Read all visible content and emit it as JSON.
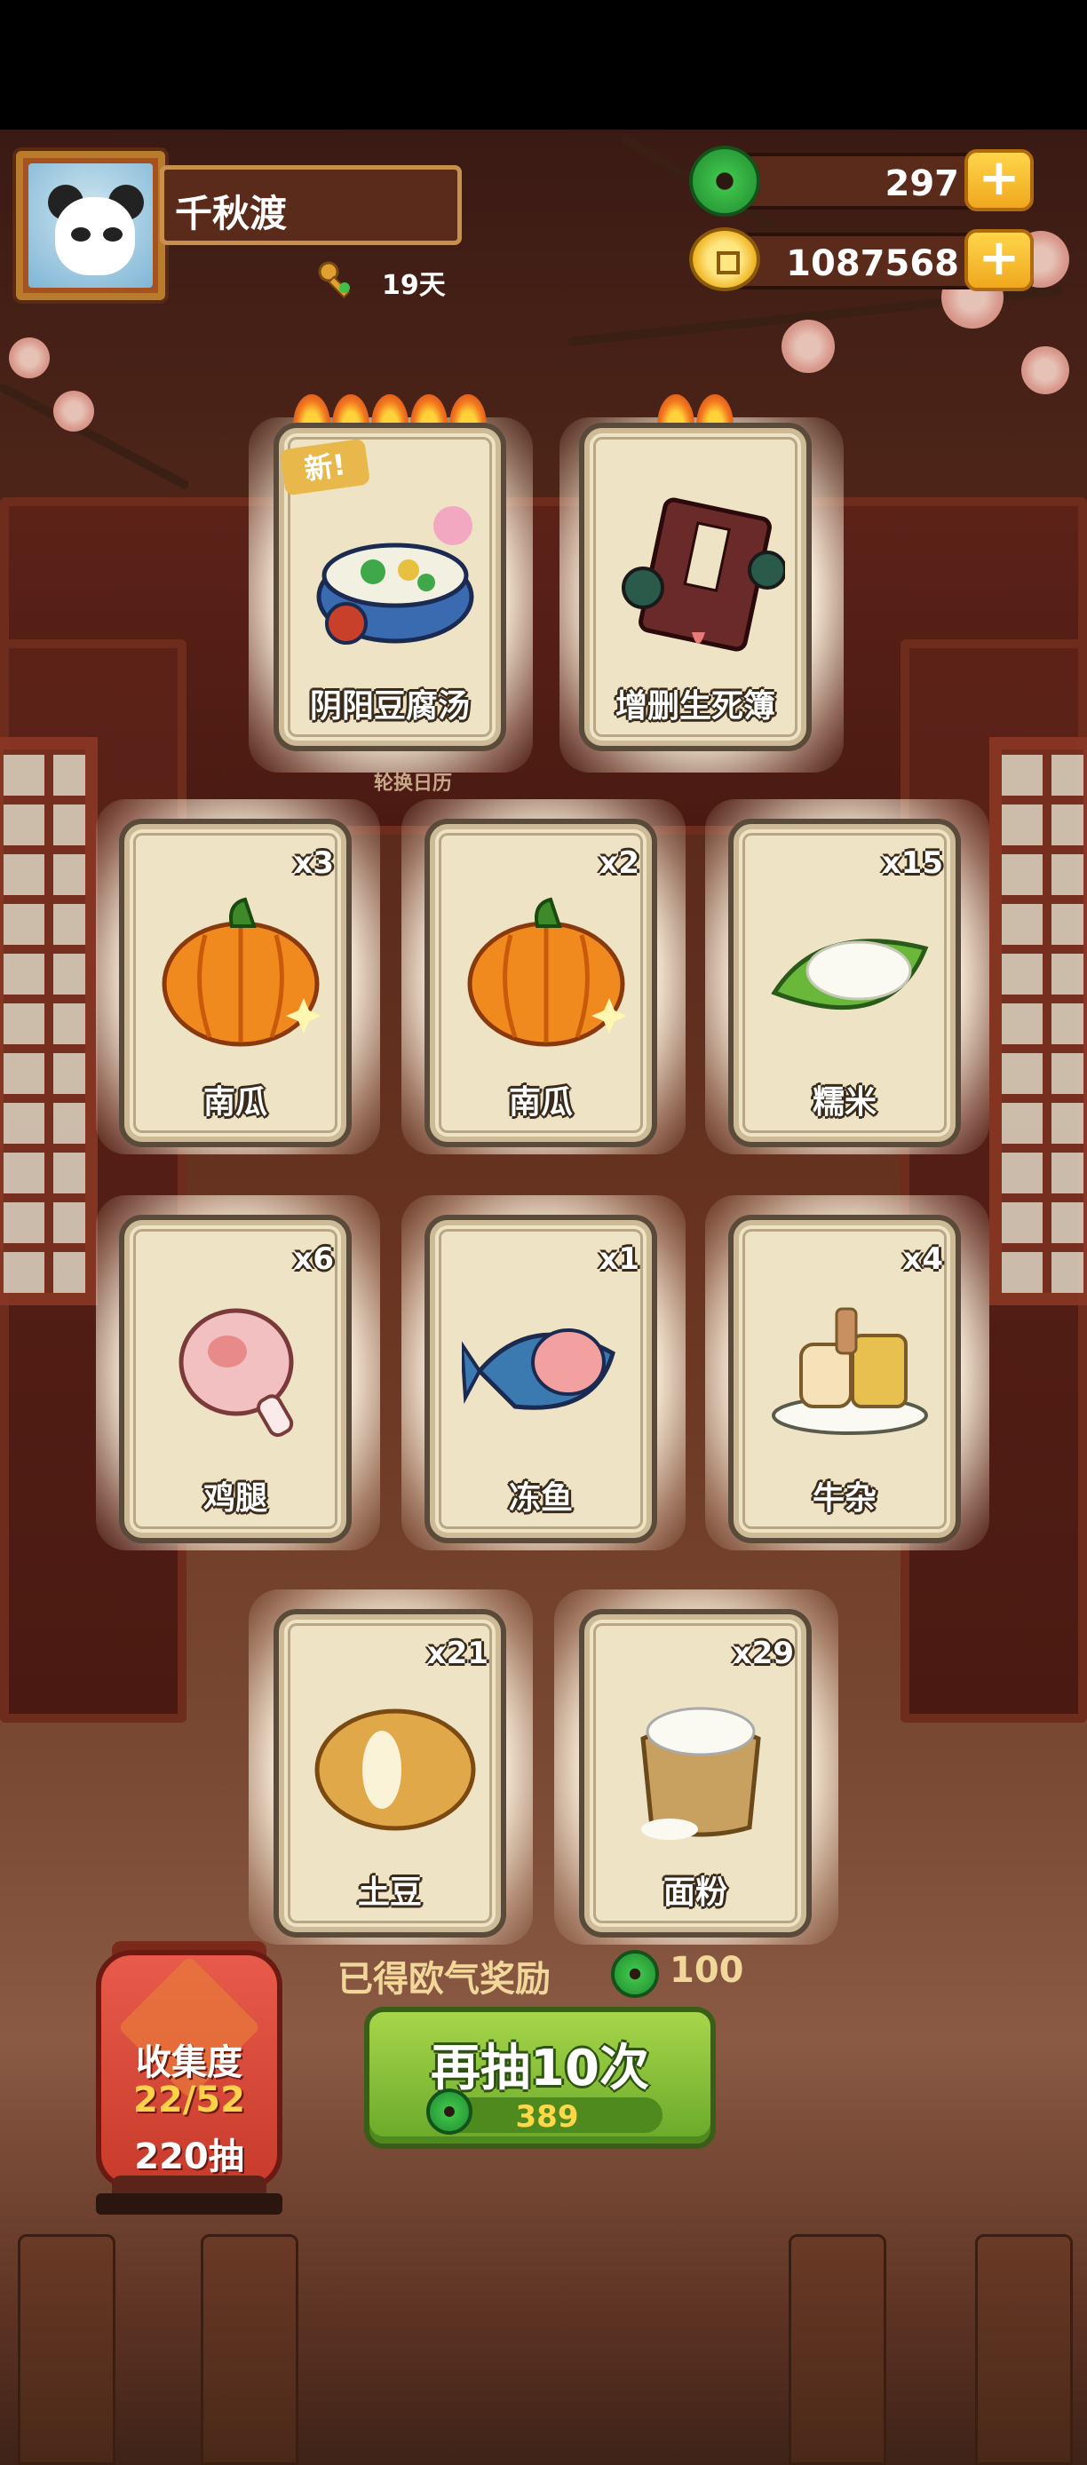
{
  "player": {
    "name": "千秋渡",
    "days": "19天"
  },
  "currency": {
    "jade": "297",
    "coins": "1087568"
  },
  "featured_cards": [
    {
      "label": "阴阳豆腐汤",
      "badge": "新!",
      "stars": 5
    },
    {
      "label": "增删生死簿",
      "stars": 2
    }
  ],
  "caption": "轮换日历",
  "cards": [
    {
      "label": "南瓜",
      "count": "x3",
      "icon": "pumpkin-icon"
    },
    {
      "label": "南瓜",
      "count": "x2",
      "icon": "pumpkin-icon"
    },
    {
      "label": "糯米",
      "count": "x15",
      "icon": "rice-icon"
    },
    {
      "label": "鸡腿",
      "count": "x6",
      "icon": "drumstick-icon"
    },
    {
      "label": "冻鱼",
      "count": "x1",
      "icon": "fish-icon"
    },
    {
      "label": "牛杂",
      "count": "x4",
      "icon": "beef-offal-icon"
    },
    {
      "label": "土豆",
      "count": "x21",
      "icon": "potato-icon"
    },
    {
      "label": "面粉",
      "count": "x29",
      "icon": "flour-icon"
    }
  ],
  "reward": {
    "text": "已得欧气奖励",
    "value": "100"
  },
  "draw_button": {
    "label": "再抽10次",
    "cost": "389"
  },
  "collection": {
    "title": "收集度",
    "progress": "22/52",
    "draws": "220抽"
  },
  "colors": {
    "accent_green": "#6aa82a",
    "gold": "#f0a81e",
    "lantern_red": "#c83a2a"
  }
}
